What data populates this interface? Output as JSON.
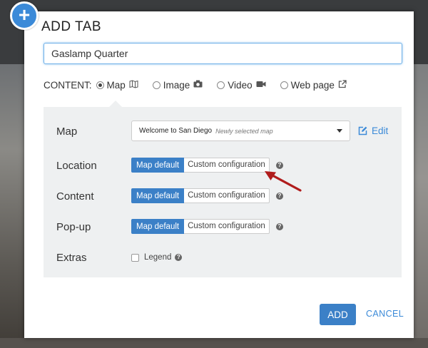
{
  "dialog": {
    "title": "ADD TAB",
    "name_value": "Gaslamp Quarter"
  },
  "content": {
    "label": "CONTENT:",
    "options": [
      {
        "label": "Map",
        "icon": "map-icon",
        "checked": true
      },
      {
        "label": "Image",
        "icon": "camera-icon",
        "checked": false
      },
      {
        "label": "Video",
        "icon": "video-camera-icon",
        "checked": false
      },
      {
        "label": "Web page",
        "icon": "external-link-icon",
        "checked": false
      }
    ]
  },
  "map_row": {
    "label": "Map",
    "selected": "Welcome to San Diego",
    "selected_note": "Newly selected map",
    "edit_label": "Edit"
  },
  "rows": {
    "location": {
      "label": "Location",
      "default": "Map default",
      "custom": "Custom configuration"
    },
    "content": {
      "label": "Content",
      "default": "Map default",
      "custom": "Custom configuration"
    },
    "popup": {
      "label": "Pop-up",
      "default": "Map default",
      "custom": "Custom configuration"
    }
  },
  "extras": {
    "label": "Extras",
    "legend_label": "Legend",
    "legend_checked": false
  },
  "footer": {
    "add_label": "ADD",
    "cancel_label": "CANCEL"
  },
  "colors": {
    "accent": "#3b80c7",
    "link": "#3b8ad8",
    "annotation_arrow": "#b01c1c"
  }
}
